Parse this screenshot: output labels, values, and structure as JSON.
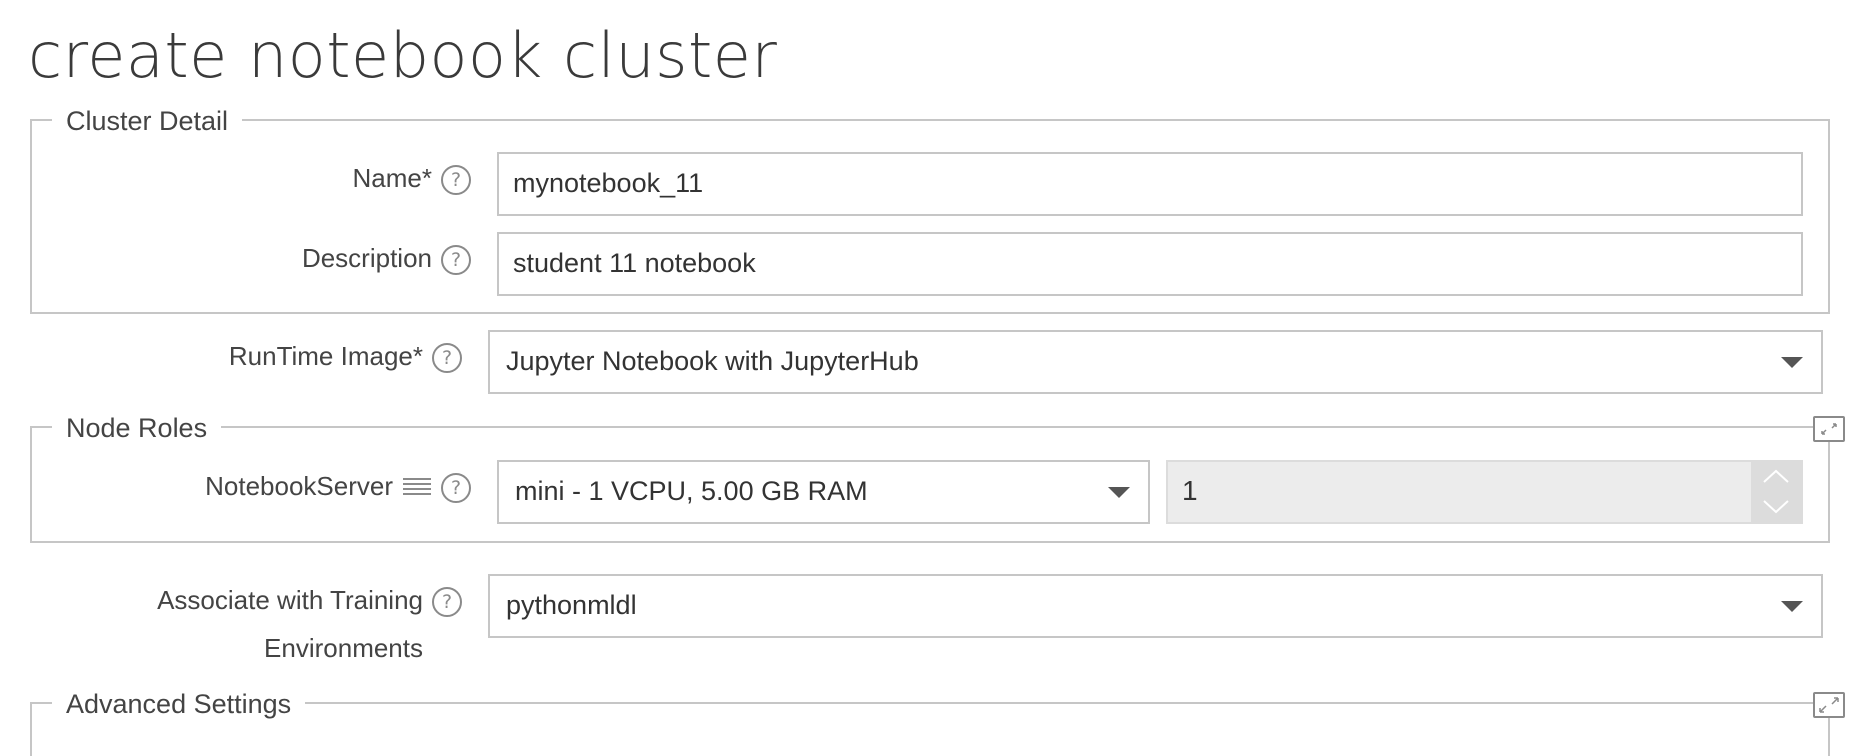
{
  "page": {
    "title": "create notebook cluster"
  },
  "cluster_detail": {
    "legend": "Cluster Detail",
    "name": {
      "label": "Name*",
      "value": "mynotebook_11"
    },
    "description": {
      "label": "Description",
      "value": "student 11 notebook"
    }
  },
  "runtime_image": {
    "label": "RunTime Image*",
    "selected": "Jupyter Notebook with JupyterHub"
  },
  "node_roles": {
    "legend": "Node Roles",
    "notebook_server": {
      "label": "NotebookServer",
      "flavor_selected": "mini - 1 VCPU, 5.00 GB RAM",
      "count": "1"
    }
  },
  "training_env": {
    "label_line1": "Associate with Training",
    "label_line2": "Environments",
    "selected": "pythonmldl"
  },
  "advanced_settings": {
    "legend": "Advanced Settings"
  },
  "icons": {
    "help": "help-circle-icon",
    "menu": "list-icon",
    "collapse": "collapse-icon",
    "expand": "expand-icon",
    "caret": "chevron-down-icon"
  },
  "colors": {
    "border": "#c6c6c6",
    "text": "#333333",
    "disabled_bg": "#ececec"
  }
}
